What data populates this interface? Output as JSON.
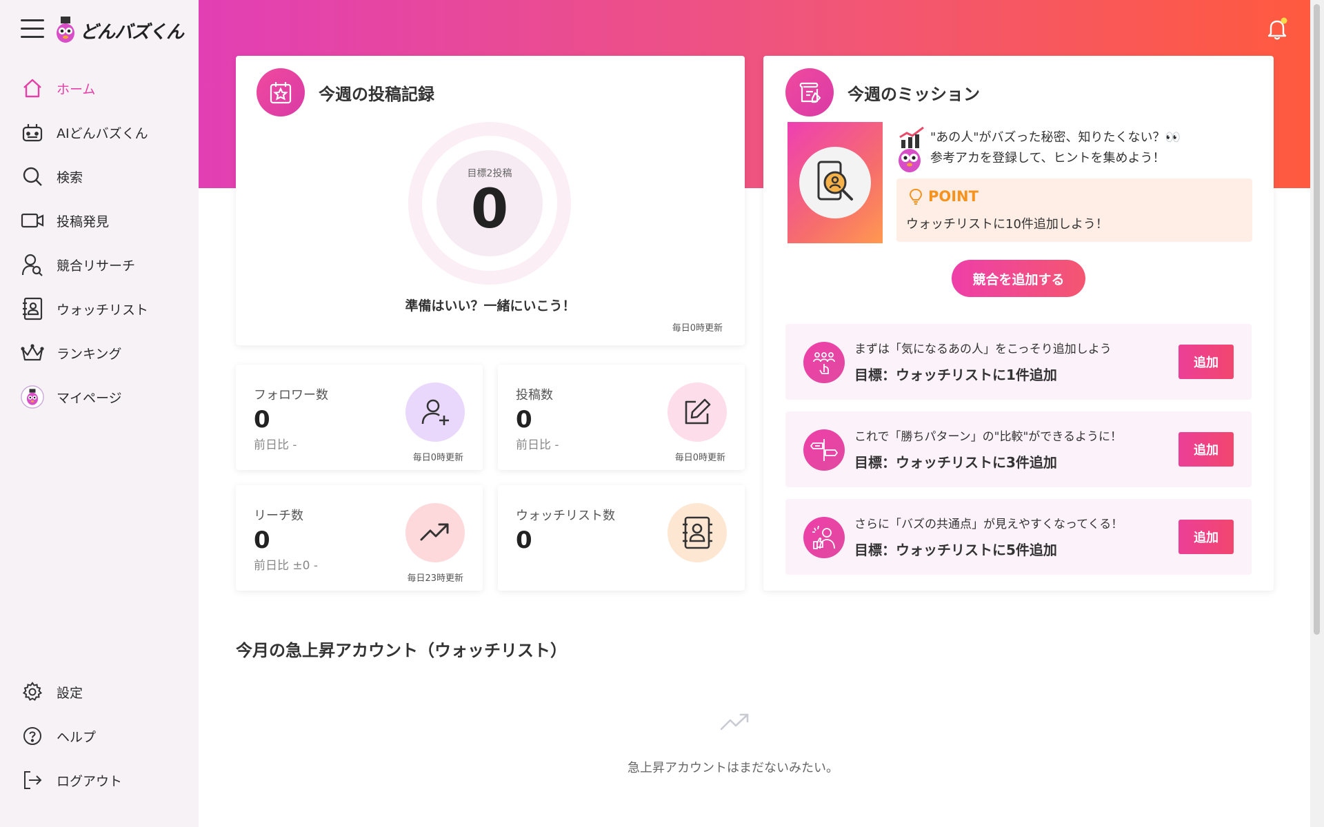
{
  "app": {
    "logo_text": "どんバズくん"
  },
  "sidebar": {
    "items": [
      {
        "label": "ホーム",
        "icon": "home-icon",
        "active": true
      },
      {
        "label": "AIどんバズくん",
        "icon": "robot-icon"
      },
      {
        "label": "検索",
        "icon": "search-icon"
      },
      {
        "label": "投稿発見",
        "icon": "video-icon"
      },
      {
        "label": "競合リサーチ",
        "icon": "person-search-icon"
      },
      {
        "label": "ウォッチリスト",
        "icon": "contact-book-icon"
      },
      {
        "label": "ランキング",
        "icon": "crown-icon"
      },
      {
        "label": "マイページ",
        "icon": "mascot-avatar-icon"
      }
    ],
    "bottom": [
      {
        "label": "設定",
        "icon": "gear-icon"
      },
      {
        "label": "ヘルプ",
        "icon": "help-icon"
      },
      {
        "label": "ログアウト",
        "icon": "logout-icon"
      }
    ]
  },
  "weekly_posts": {
    "title": "今週の投稿記録",
    "goal_label": "目標2投稿",
    "count": "0",
    "cheer": "準備はいい？一緒にいこう！",
    "update_note": "毎日0時更新"
  },
  "stats": {
    "followers": {
      "label": "フォロワー数",
      "value": "0",
      "sub": "前日比 -",
      "note": "毎日0時更新"
    },
    "posts": {
      "label": "投稿数",
      "value": "0",
      "sub": "前日比 -",
      "note": "毎日0時更新"
    },
    "reach": {
      "label": "リーチ数",
      "value": "0",
      "sub": "前日比 ±0 -",
      "note": "毎日23時更新"
    },
    "watchlist": {
      "label": "ウォッチリスト数",
      "value": "0"
    }
  },
  "mission": {
    "title": "今週のミッション",
    "intro_line1": "\"あの人\"がバズった秘密、知りたくない？👀",
    "intro_line2": "参考アカを登録して、ヒントを集めよう！",
    "point_title": "POINT",
    "point_text": "ウォッチリストに10件追加しよう！",
    "cta_label": "競合を追加する",
    "tasks": [
      {
        "line1": "まずは「気になるあの人」をこっそり追加しよう",
        "line2": "目標：ウォッチリストに1件追加",
        "button": "追加"
      },
      {
        "line1": "これで「勝ちパターン」の\"比較\"ができるように！",
        "line2": "目標：ウォッチリストに3件追加",
        "button": "追加"
      },
      {
        "line1": "さらに「バズの共通点」が見えやすくなってくる！",
        "line2": "目標：ウォッチリストに5件追加",
        "button": "追加"
      }
    ]
  },
  "rising": {
    "title": "今月の急上昇アカウント（ウォッチリスト）",
    "empty_text": "急上昇アカウントはまだないみたい。"
  },
  "colors": {
    "accent": "#e63fa6",
    "gradient_start": "#e23fb4",
    "gradient_end": "#ff5a3f",
    "point": "#f5931e"
  }
}
